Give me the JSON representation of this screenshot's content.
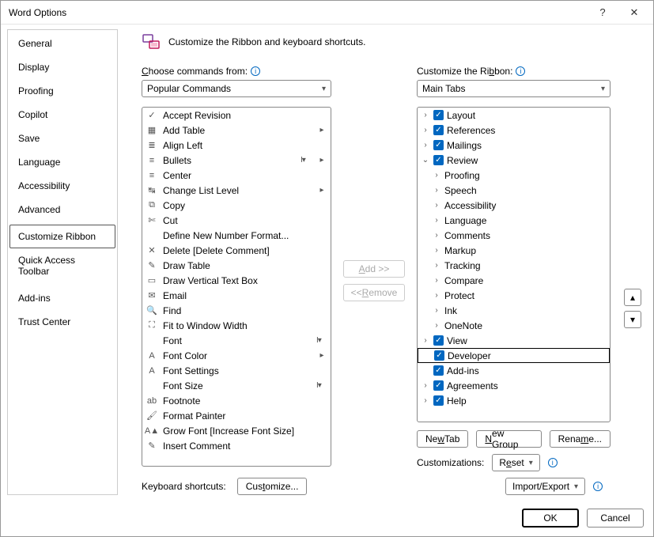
{
  "window": {
    "title": "Word Options"
  },
  "nav": {
    "items": [
      "General",
      "Display",
      "Proofing",
      "Copilot",
      "Save",
      "Language",
      "Accessibility",
      "Advanced",
      "Customize Ribbon",
      "Quick Access Toolbar",
      "Add-ins",
      "Trust Center"
    ],
    "selected": "Customize Ribbon"
  },
  "heading": "Customize the Ribbon and keyboard shortcuts.",
  "left_col": {
    "label": "Choose commands from:",
    "dropdown": "Popular Commands",
    "commands": [
      {
        "icon": "✓",
        "label": "Accept Revision"
      },
      {
        "icon": "▦",
        "label": "Add Table",
        "arrow": true
      },
      {
        "icon": "≣",
        "label": "Align Left"
      },
      {
        "icon": "≡",
        "label": "Bullets",
        "pop": true,
        "arrow": true
      },
      {
        "icon": "≡",
        "label": "Center"
      },
      {
        "icon": "↹",
        "label": "Change List Level",
        "arrow": true
      },
      {
        "icon": "⧉",
        "label": "Copy"
      },
      {
        "icon": "✄",
        "label": "Cut"
      },
      {
        "icon": "",
        "label": "Define New Number Format..."
      },
      {
        "icon": "✕",
        "label": "Delete [Delete Comment]"
      },
      {
        "icon": "✎",
        "label": "Draw Table"
      },
      {
        "icon": "▭",
        "label": "Draw Vertical Text Box"
      },
      {
        "icon": "✉",
        "label": "Email"
      },
      {
        "icon": "🔍",
        "label": "Find"
      },
      {
        "icon": "⛶",
        "label": "Fit to Window Width"
      },
      {
        "icon": "",
        "label": "Font",
        "pop": true
      },
      {
        "icon": "A",
        "label": "Font Color",
        "arrow": true
      },
      {
        "icon": "A",
        "label": "Font Settings"
      },
      {
        "icon": "",
        "label": "Font Size",
        "pop": true
      },
      {
        "icon": "ab",
        "label": "Footnote"
      },
      {
        "icon": "🖌",
        "label": "Format Painter"
      },
      {
        "icon": "A▲",
        "label": "Grow Font [Increase Font Size]"
      },
      {
        "icon": "✎",
        "label": "Insert Comment"
      }
    ]
  },
  "mid_buttons": {
    "add": "Add >>",
    "remove": "<< Remove"
  },
  "right_col": {
    "label": "Customize the Ribbon:",
    "dropdown": "Main Tabs",
    "tree": [
      {
        "d": 0,
        "exp": ">",
        "chk": true,
        "label": "Layout"
      },
      {
        "d": 0,
        "exp": ">",
        "chk": true,
        "label": "References"
      },
      {
        "d": 0,
        "exp": ">",
        "chk": true,
        "label": "Mailings"
      },
      {
        "d": 0,
        "exp": "v",
        "chk": true,
        "label": "Review"
      },
      {
        "d": 1,
        "exp": ">",
        "label": "Proofing"
      },
      {
        "d": 1,
        "exp": ">",
        "label": "Speech"
      },
      {
        "d": 1,
        "exp": ">",
        "label": "Accessibility"
      },
      {
        "d": 1,
        "exp": ">",
        "label": "Language"
      },
      {
        "d": 1,
        "exp": ">",
        "label": "Comments"
      },
      {
        "d": 1,
        "exp": ">",
        "label": "Markup"
      },
      {
        "d": 1,
        "exp": ">",
        "label": "Tracking"
      },
      {
        "d": 1,
        "exp": ">",
        "label": "Compare"
      },
      {
        "d": 1,
        "exp": ">",
        "label": "Protect"
      },
      {
        "d": 1,
        "exp": ">",
        "label": "Ink"
      },
      {
        "d": 1,
        "exp": ">",
        "label": "OneNote"
      },
      {
        "d": 0,
        "exp": ">",
        "chk": true,
        "label": "View"
      },
      {
        "d": 0,
        "exp": "",
        "chk": true,
        "label": "Developer",
        "selected": true
      },
      {
        "d": 0,
        "exp": "",
        "chk": true,
        "label": "Add-ins"
      },
      {
        "d": 0,
        "exp": ">",
        "chk": true,
        "label": "Agreements"
      },
      {
        "d": 0,
        "exp": ">",
        "chk": true,
        "label": "Help"
      }
    ],
    "buttons": {
      "new_tab": "New Tab",
      "new_group": "New Group",
      "rename": "Rename..."
    },
    "customizations_label": "Customizations:",
    "reset": "Reset",
    "import_export": "Import/Export"
  },
  "keyboard": {
    "label": "Keyboard shortcuts:",
    "button": "Customize..."
  },
  "footer": {
    "ok": "OK",
    "cancel": "Cancel"
  }
}
